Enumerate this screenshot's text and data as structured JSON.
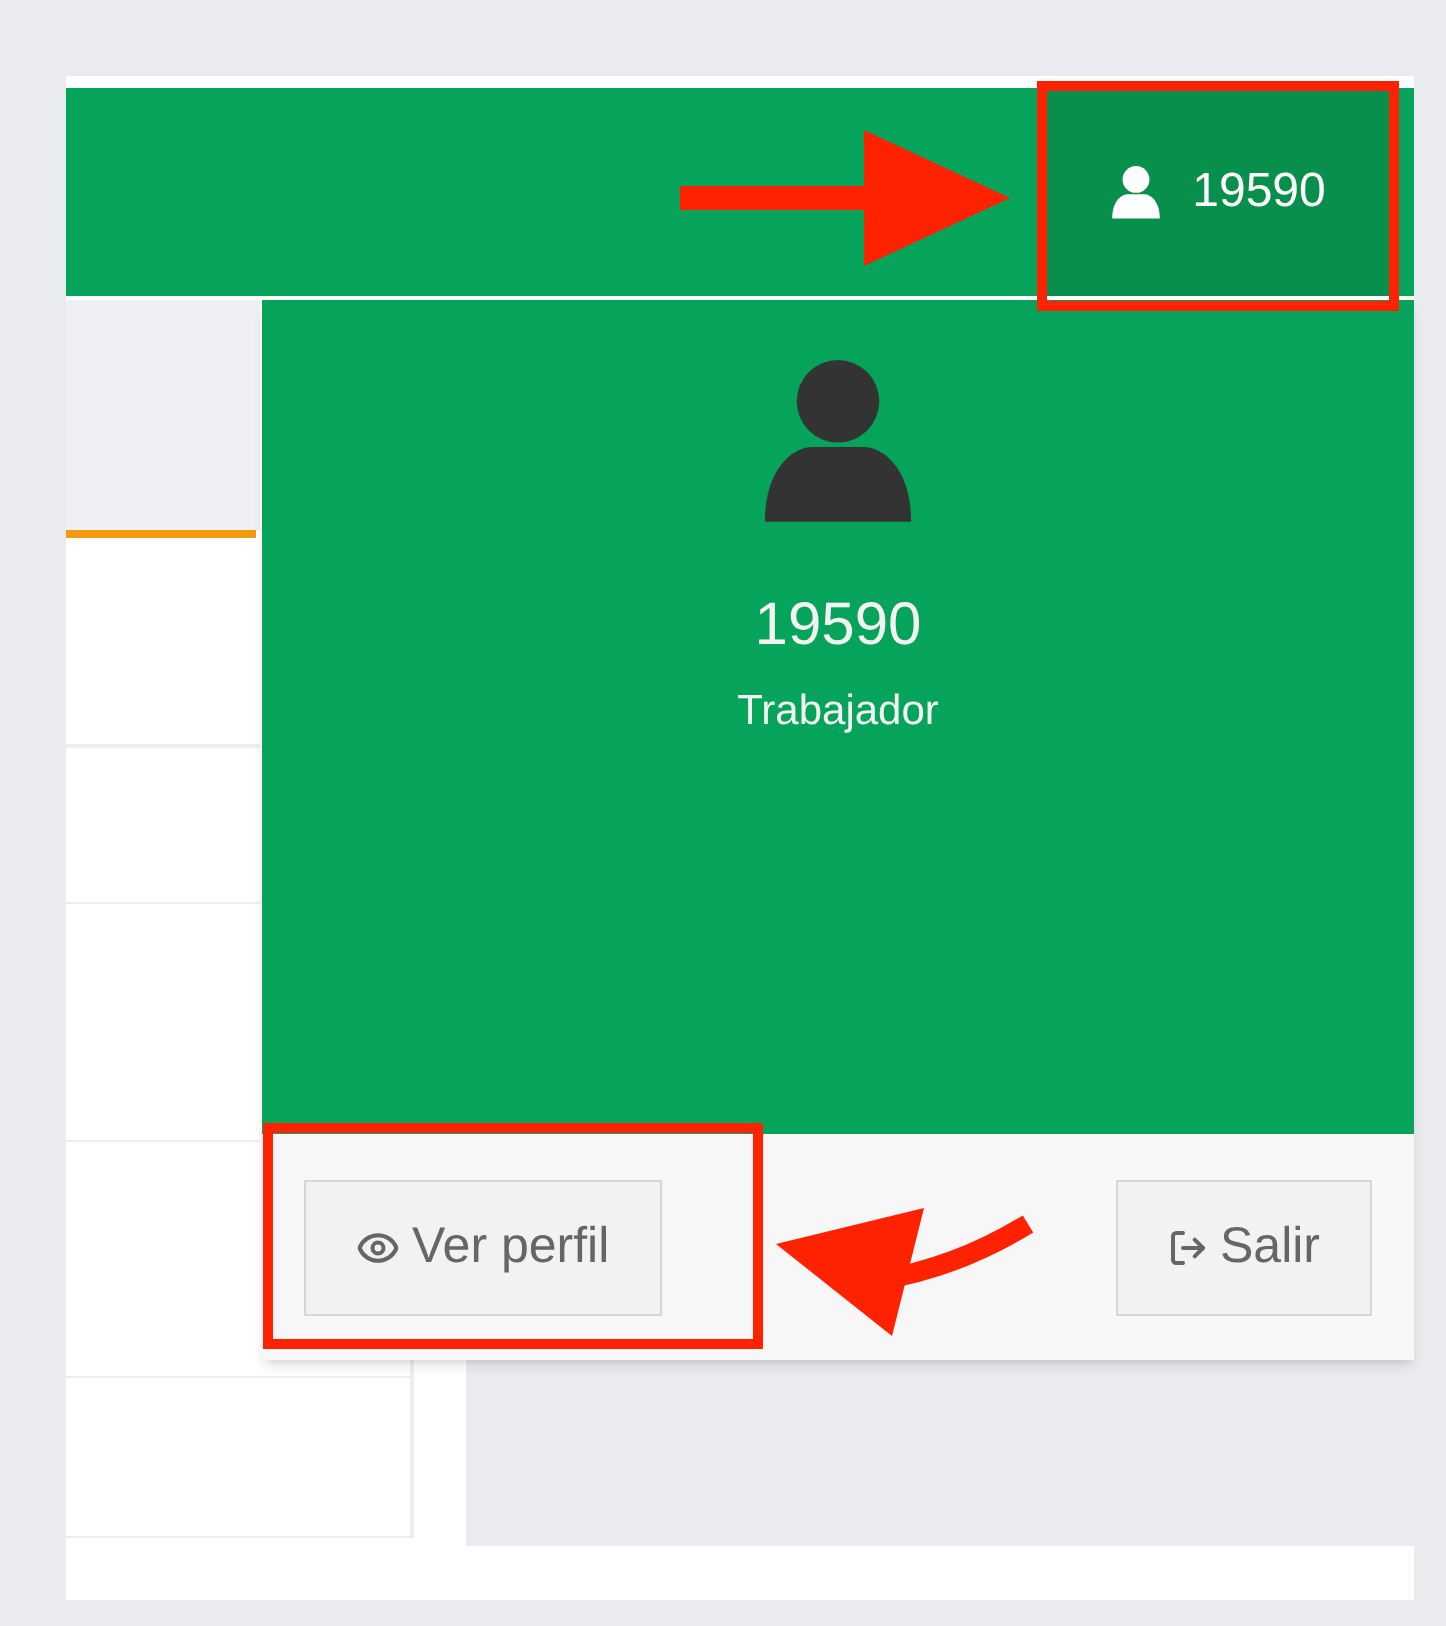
{
  "header": {
    "user_button": {
      "label": "19590"
    }
  },
  "user_menu": {
    "name": "19590",
    "role": "Trabajador",
    "buttons": [
      {
        "label": "Ver perfil",
        "kind": "profile"
      },
      {
        "label": "Salir",
        "kind": "logout"
      }
    ]
  }
}
